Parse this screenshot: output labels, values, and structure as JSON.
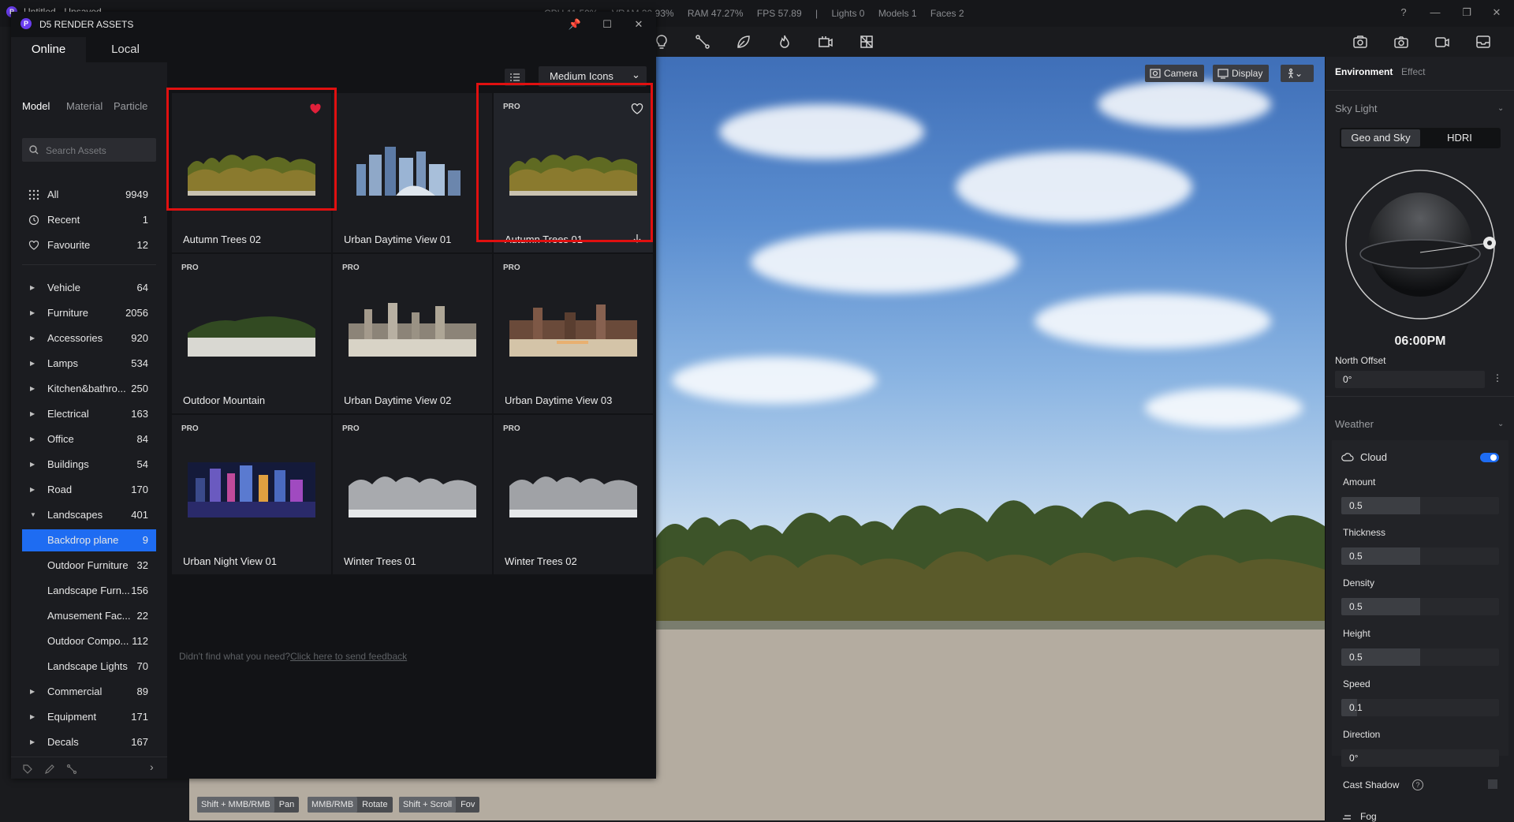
{
  "app": {
    "title": "Untitled - Unsaved",
    "logo": "P",
    "stats": [
      "CPU 11.59%",
      "VRAM 30.93%",
      "RAM 47.27%",
      "FPS 57.89",
      "|",
      "Lights 0",
      "Models 1",
      "Faces 2"
    ],
    "window_controls": {
      "help": "?",
      "minimize": "—",
      "restore": "❐",
      "close": "✕"
    }
  },
  "viewport": {
    "camera_label": "Camera",
    "display_label": "Display",
    "hints": [
      {
        "key": "Shift + MMB/RMB",
        "action": "Pan"
      },
      {
        "key": "MMB/RMB",
        "action": "Rotate"
      },
      {
        "key": "Shift + Scroll",
        "action": "Fov"
      }
    ]
  },
  "assets": {
    "title": "D5 RENDER ASSETS",
    "logo": "P",
    "tabs": {
      "online": "Online",
      "local": "Local"
    },
    "categories": {
      "model": "Model",
      "material": "Material",
      "particle": "Particle"
    },
    "search_placeholder": "Search Assets",
    "view_mode": "Medium Icons",
    "sidebar": [
      {
        "label": "All",
        "count": "9949",
        "icon": "grid-icon"
      },
      {
        "label": "Recent",
        "count": "1",
        "icon": "clock-icon"
      },
      {
        "label": "Favourite",
        "count": "12",
        "icon": "heart-icon"
      },
      {
        "label": "Vehicle",
        "count": "64"
      },
      {
        "label": "Furniture",
        "count": "2056"
      },
      {
        "label": "Accessories",
        "count": "920"
      },
      {
        "label": "Lamps",
        "count": "534"
      },
      {
        "label": "Kitchen&bathro...",
        "count": "250"
      },
      {
        "label": "Electrical",
        "count": "163"
      },
      {
        "label": "Office",
        "count": "84"
      },
      {
        "label": "Buildings",
        "count": "54"
      },
      {
        "label": "Road",
        "count": "170"
      },
      {
        "label": "Landscapes",
        "count": "401"
      },
      {
        "label": "Backdrop plane",
        "count": "9"
      },
      {
        "label": "Outdoor Furniture",
        "count": "32"
      },
      {
        "label": "Landscape Furn...",
        "count": "156"
      },
      {
        "label": "Amusement Fac...",
        "count": "22"
      },
      {
        "label": "Outdoor Compo...",
        "count": "112"
      },
      {
        "label": "Landscape Lights",
        "count": "70"
      },
      {
        "label": "Commercial",
        "count": "89"
      },
      {
        "label": "Equipment",
        "count": "171"
      },
      {
        "label": "Decals",
        "count": "167"
      }
    ],
    "tiles": [
      {
        "name": "Autumn Trees 02",
        "pro": "",
        "kind": "autumn"
      },
      {
        "name": "Urban Daytime View 01",
        "pro": "",
        "kind": "city-blue"
      },
      {
        "name": "Autumn Trees 01",
        "pro": "PRO",
        "kind": "autumn"
      },
      {
        "name": "Outdoor Mountain",
        "pro": "PRO",
        "kind": "island"
      },
      {
        "name": "Urban Daytime View 02",
        "pro": "PRO",
        "kind": "city-day"
      },
      {
        "name": "Urban Daytime View 03",
        "pro": "PRO",
        "kind": "city-dusk"
      },
      {
        "name": "Urban Night View 01",
        "pro": "PRO",
        "kind": "city-night"
      },
      {
        "name": "Winter Trees 01",
        "pro": "PRO",
        "kind": "winter"
      },
      {
        "name": "Winter Trees 02",
        "pro": "PRO",
        "kind": "winter"
      }
    ],
    "feedback_text": "Didn't find what you need?",
    "feedback_link": "Click here to send feedback"
  },
  "right_panel": {
    "tabs": {
      "environment": "Environment",
      "effect": "Effect"
    },
    "sky_light": "Sky Light",
    "sky_modes": {
      "geo": "Geo and Sky",
      "hdri": "HDRI"
    },
    "time": "06:00PM",
    "north_offset_label": "North Offset",
    "north_offset_value": "0°",
    "weather": "Weather",
    "cloud_label": "Cloud",
    "cloud_enabled": true,
    "params": [
      {
        "label": "Amount",
        "value": "0.5",
        "fraction": 0.5
      },
      {
        "label": "Thickness",
        "value": "0.5",
        "fraction": 0.5
      },
      {
        "label": "Density",
        "value": "0.5",
        "fraction": 0.5
      },
      {
        "label": "Height",
        "value": "0.5",
        "fraction": 0.5
      },
      {
        "label": "Speed",
        "value": "0.1",
        "fraction": 0.1
      },
      {
        "label": "Direction",
        "value": "0°",
        "fraction": 0
      }
    ],
    "cast_shadow_label": "Cast Shadow",
    "fog_label": "Fog"
  }
}
